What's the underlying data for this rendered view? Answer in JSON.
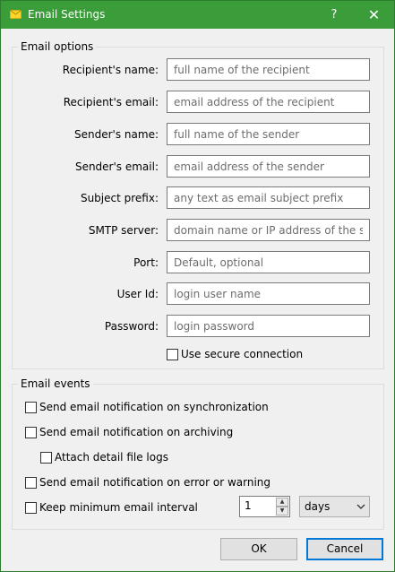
{
  "window": {
    "title": "Email Settings",
    "help_glyph": "?",
    "close_glyph": "✕"
  },
  "email_options": {
    "legend": "Email options",
    "fields": [
      {
        "label": "Recipient's name:",
        "value": "",
        "placeholder": "full name of the recipient"
      },
      {
        "label": "Recipient's email:",
        "value": "",
        "placeholder": "email address of the recipient"
      },
      {
        "label": "Sender's name:",
        "value": "",
        "placeholder": "full name of the sender"
      },
      {
        "label": "Sender's email:",
        "value": "",
        "placeholder": "email address of the sender"
      },
      {
        "label": "Subject prefix:",
        "value": "",
        "placeholder": "any text as email subject prefix"
      },
      {
        "label": "SMTP server:",
        "value": "",
        "placeholder": "domain name or IP address of the server"
      },
      {
        "label": "Port:",
        "value": "",
        "placeholder": "Default, optional"
      },
      {
        "label": "User Id:",
        "value": "",
        "placeholder": "login user name"
      },
      {
        "label": "Password:",
        "value": "",
        "placeholder": "login password"
      }
    ],
    "secure_connection": {
      "label": "Use secure connection",
      "checked": false
    }
  },
  "email_events": {
    "legend": "Email events",
    "notify_sync": {
      "label": "Send email notification on synchronization",
      "checked": false
    },
    "notify_archive": {
      "label": "Send email notification on archiving",
      "checked": false
    },
    "attach_logs": {
      "label": "Attach detail file logs",
      "checked": false
    },
    "notify_error": {
      "label": "Send email notification on error or warning",
      "checked": false
    },
    "min_interval": {
      "label": "Keep minimum email interval",
      "checked": false,
      "value": "1",
      "unit": "days"
    }
  },
  "buttons": {
    "ok": "OK",
    "cancel": "Cancel"
  },
  "colors": {
    "titlebar": "#3a9d3a",
    "focus_border": "#0078d7"
  }
}
